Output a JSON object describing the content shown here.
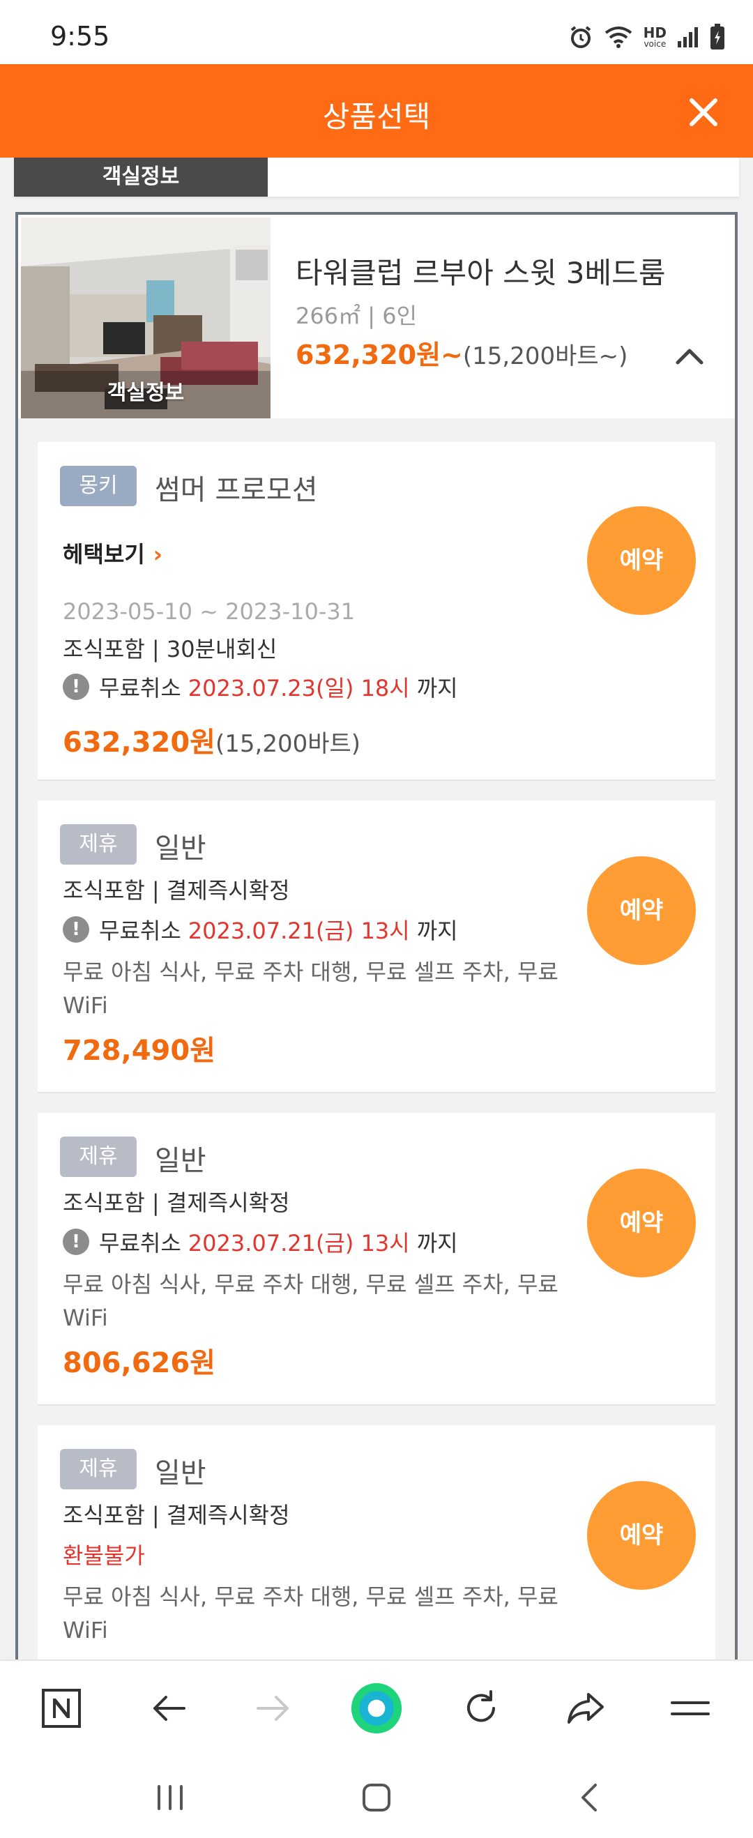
{
  "status_bar": {
    "time": "9:55",
    "hd_label": "HD",
    "voice_label": "voice"
  },
  "header": {
    "title": "상품선택"
  },
  "prev_room": {
    "photo_label": "객실정보"
  },
  "room": {
    "photo_label": "객실정보",
    "name": "타워클럽 르부아 스윗 3베드룸",
    "spec": "266㎡ | 6인",
    "price": "632,320원~",
    "price_sub": "(15,200바트~)"
  },
  "plans": [
    {
      "badge": "몽키",
      "name": "썸머 프로모션",
      "benefit_link": "헤택보기",
      "period": "2023-05-10 ~ 2023-10-31",
      "conditions": "조식포함 | 30분내회신",
      "cancel_label": "무료취소",
      "cancel_date": "2023.07.23(일) 18시",
      "cancel_suffix": "까지",
      "price": "632,320원",
      "price_sub": "(15,200바트)",
      "button": "예약"
    },
    {
      "badge": "제휴",
      "name": "일반",
      "conditions": "조식포함 | 결제즉시확정",
      "cancel_label": "무료취소",
      "cancel_date": "2023.07.21(금) 13시",
      "cancel_suffix": "까지",
      "amenities": "무료 아침 식사, 무료 주차 대행, 무료 셀프 주차, 무료 WiFi",
      "price": "728,490원",
      "button": "예약"
    },
    {
      "badge": "제휴",
      "name": "일반",
      "conditions": "조식포함 | 결제즉시확정",
      "cancel_label": "무료취소",
      "cancel_date": "2023.07.21(금) 13시",
      "cancel_suffix": "까지",
      "amenities": "무료 아침 식사, 무료 주차 대행, 무료 셀프 주차, 무료 WiFi",
      "price": "806,626원",
      "button": "예약"
    },
    {
      "badge": "제휴",
      "name": "일반",
      "conditions": "조식포함 | 결제즉시확정",
      "refund_note": "환불불가",
      "amenities": "무료 아침 식사, 무료 주차 대행, 무료 셀프 주차, 무료 WiFi",
      "button": "예약"
    }
  ],
  "colors": {
    "brand": "#ff6a14",
    "price": "#f26a10",
    "button": "#ff9c33",
    "alert": "#e2352d"
  },
  "icons": {
    "close": "close-icon",
    "collapse": "chevron-up-icon",
    "warning": "exclamation-icon",
    "naver": "naver-n-icon",
    "back": "arrow-left-icon",
    "forward": "arrow-right-icon",
    "assistant": "green-circle-icon",
    "reload": "reload-icon",
    "share": "share-icon",
    "menu": "menu-icon"
  }
}
